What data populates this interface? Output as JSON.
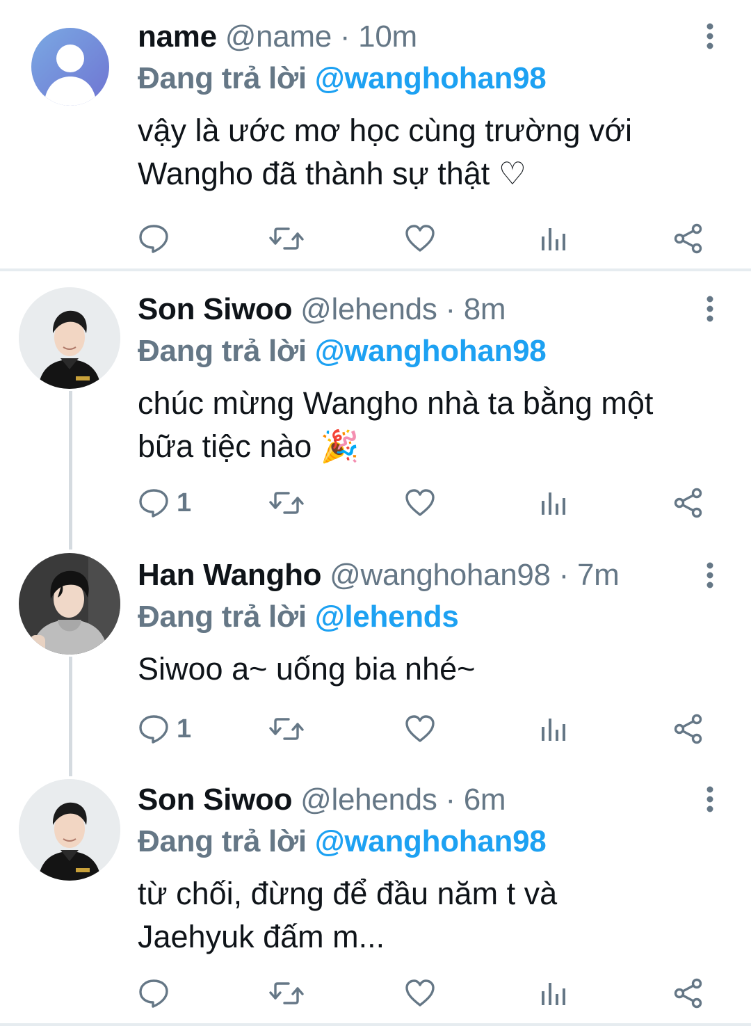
{
  "tweets": [
    {
      "name": "name",
      "handle": "@name",
      "separator": "·",
      "time": "10m",
      "reply_prefix": "Đang trả lời",
      "reply_to": "@wanghohan98",
      "text_lines": [
        "vậy là ước mơ học cùng trường với",
        "Wangho đã thành sự thật ♡"
      ],
      "reply_count": "",
      "avatar": "default-profile-icon"
    },
    {
      "name": "Son Siwoo",
      "handle": "@lehends",
      "separator": "·",
      "time": "8m",
      "reply_prefix": "Đang trả lời",
      "reply_to": "@wanghohan98",
      "text_lines": [
        "chúc mừng Wangho nhà ta bằng một",
        "bữa tiệc nào 🎉"
      ],
      "reply_count": "1",
      "avatar": "user-photo"
    },
    {
      "name": "Han Wangho",
      "handle": "@wanghohan98",
      "separator": "·",
      "time": "7m",
      "reply_prefix": "Đang trả lời",
      "reply_to": "@lehends",
      "text_lines": [
        "Siwoo a~ uống bia nhé~"
      ],
      "reply_count": "1",
      "avatar": "user-photo"
    },
    {
      "name": "Son Siwoo",
      "handle": "@lehends",
      "separator": "·",
      "time": "6m",
      "reply_prefix": "Đang trả lời",
      "reply_to": "@wanghohan98",
      "text_lines": [
        "từ chối, đừng để đầu năm t và",
        "Jaehyuk đấm m..."
      ],
      "reply_count": "",
      "avatar": "user-photo"
    }
  ],
  "icons": {
    "reply": "reply-icon",
    "retweet": "retweet-icon",
    "like": "heart-icon",
    "analytics": "analytics-icon",
    "share": "share-icon",
    "more": "more-vertical-icon"
  },
  "colors": {
    "link": "#1da1f2",
    "secondary": "#657786",
    "text": "#0f1419",
    "divider": "#e6ecf0",
    "thread_line": "#d5dbe0"
  }
}
